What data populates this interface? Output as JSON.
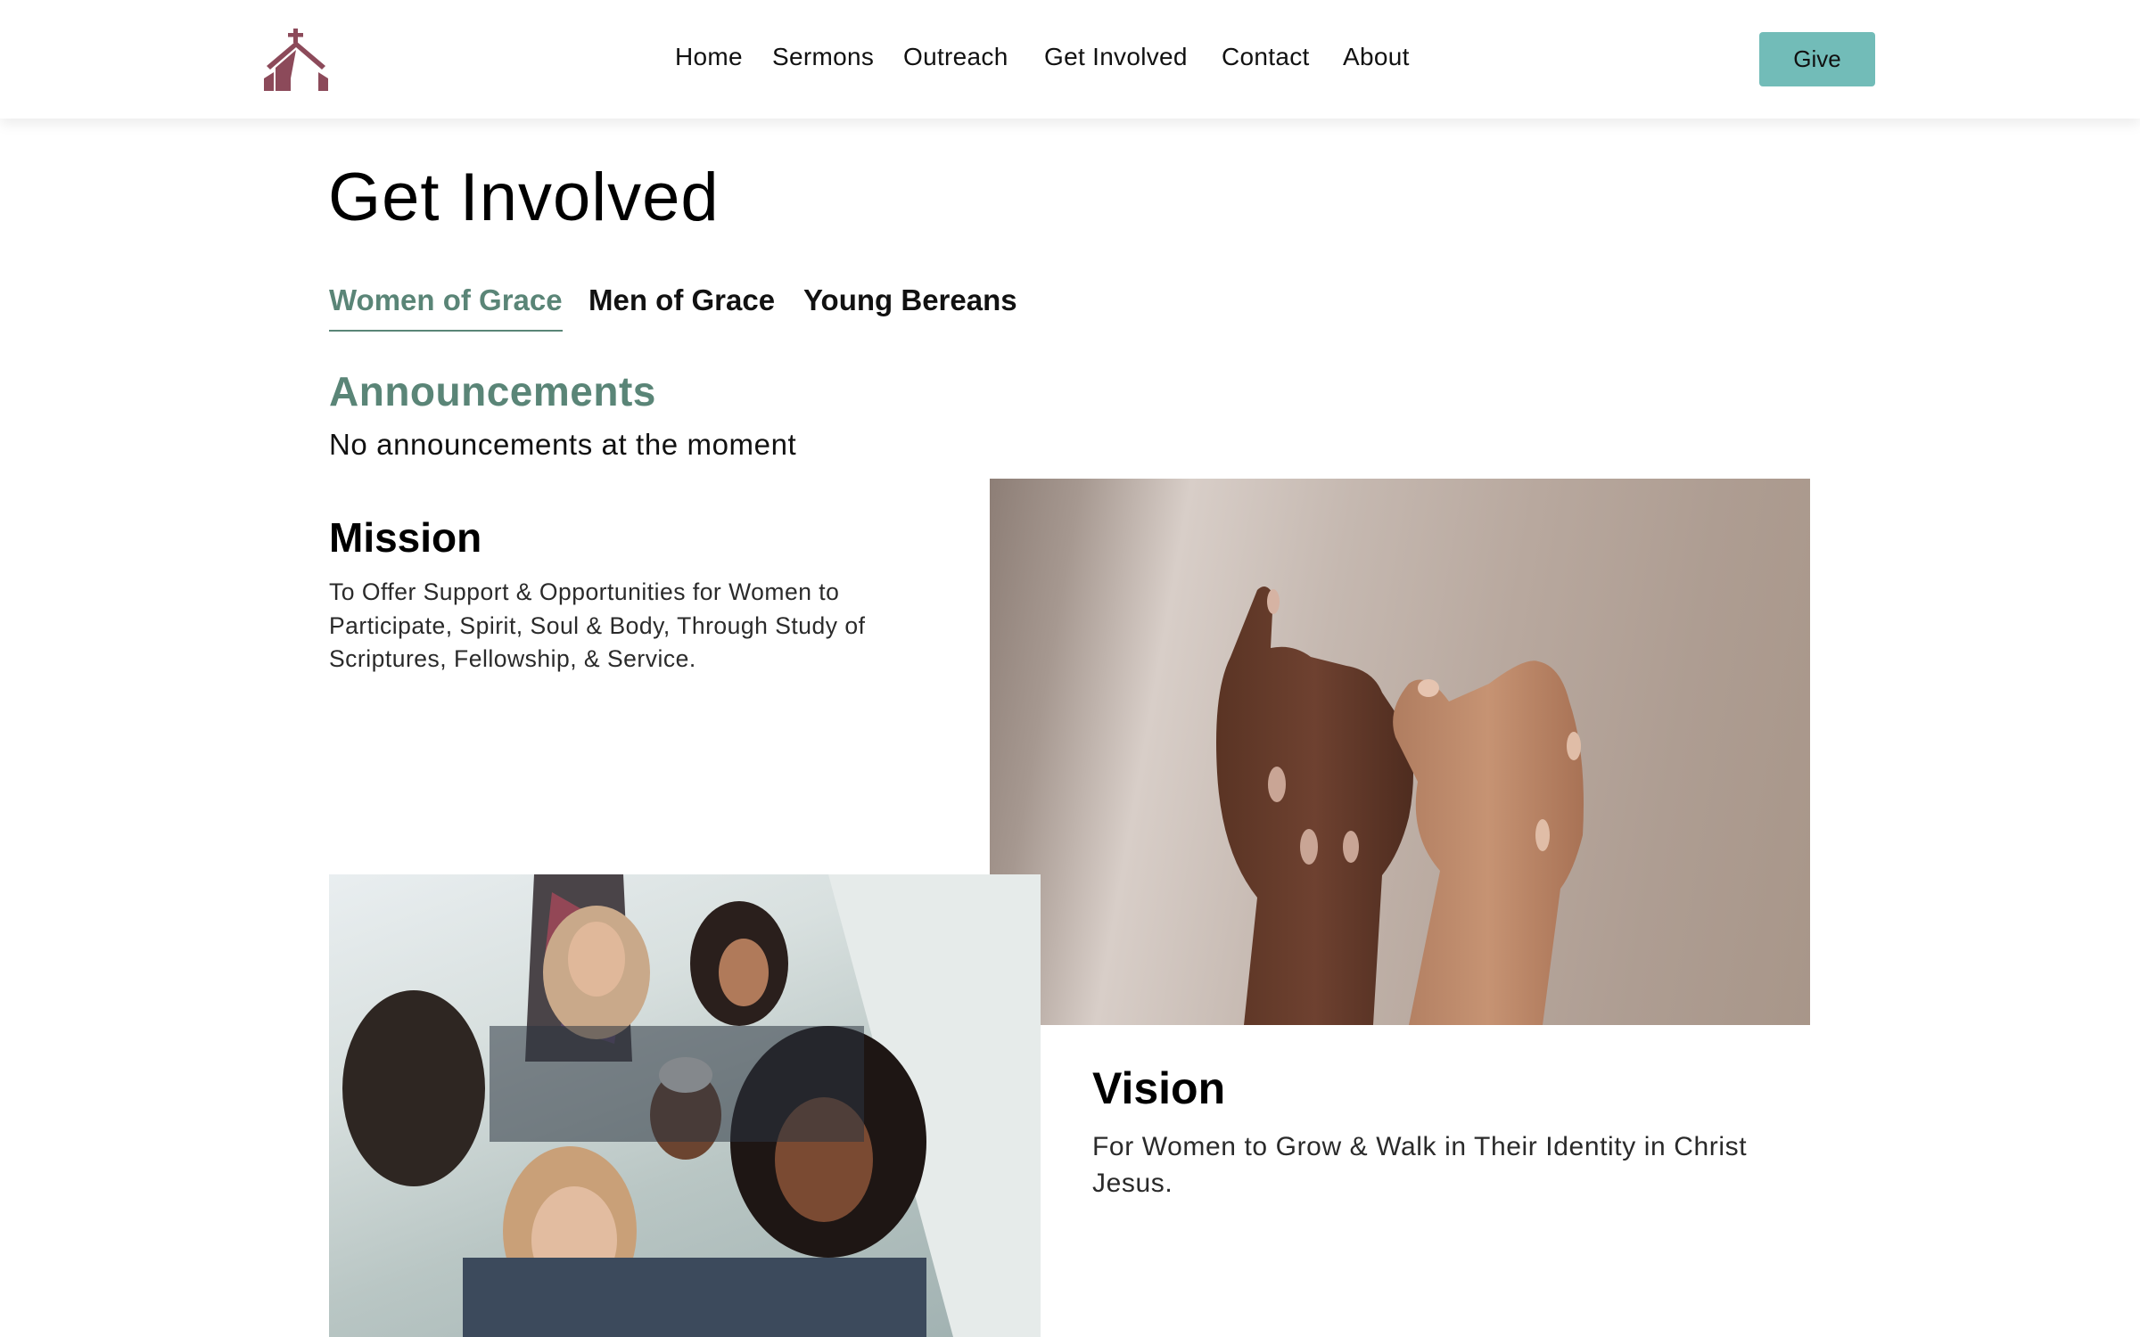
{
  "header": {
    "logo_icon": "church-icon",
    "brand_color": "#8c4a5a",
    "nav": [
      {
        "label": "Home"
      },
      {
        "label": "Sermons"
      },
      {
        "label": "Outreach"
      },
      {
        "label": "Get Involved"
      },
      {
        "label": "Contact"
      },
      {
        "label": "About"
      }
    ],
    "give_label": "Give",
    "give_color": "#72bcb8"
  },
  "page": {
    "title": "Get Involved",
    "accent_color": "#5a8577",
    "tabs": [
      {
        "label": "Women of Grace",
        "active": true
      },
      {
        "label": "Men of Grace",
        "active": false
      },
      {
        "label": "Young Bereans",
        "active": false
      }
    ],
    "announcements": {
      "title": "Announcements",
      "text": "No announcements at the moment"
    },
    "mission": {
      "title": "Mission",
      "text": "To Offer Support & Opportunities for Women to Participate, Spirit, Soul & Body, Through Study of Scriptures, Fellowship, & Service."
    },
    "vision": {
      "title": "Vision",
      "text": "For Women to Grow & Walk in Their Identity in Christ Jesus."
    },
    "images": {
      "hands": "Two hands with linked pinky fingers",
      "women": "Group of smiling women on a staircase"
    }
  }
}
